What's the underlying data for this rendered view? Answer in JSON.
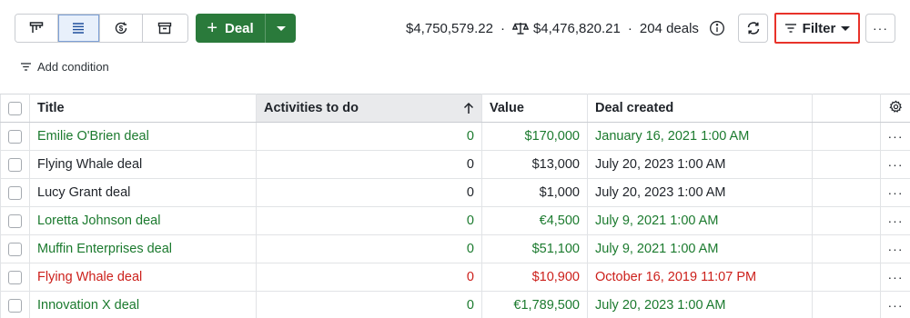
{
  "toolbar": {
    "views": [
      {
        "name": "pipeline-view",
        "icon": "kanban-icon",
        "active": false
      },
      {
        "name": "list-view",
        "icon": "list-icon",
        "active": true
      },
      {
        "name": "forecast-view",
        "icon": "dollar-cycle-icon",
        "active": false
      },
      {
        "name": "archive-view",
        "icon": "archive-icon",
        "active": false
      }
    ],
    "deal_label": "Deal",
    "summary": {
      "total": "$4,750,579.22",
      "weighted": "$4,476,820.21",
      "count": "204 deals"
    },
    "filter_label": "Filter",
    "add_condition_label": "Add condition"
  },
  "table": {
    "columns": [
      "Title",
      "Activities to do",
      "Value",
      "Deal created"
    ],
    "rows": [
      {
        "title": "Emilie O'Brien deal",
        "activities": "0",
        "value": "$170,000",
        "created": "January 16, 2021 1:00 AM",
        "status": "green"
      },
      {
        "title": "Flying Whale deal",
        "activities": "0",
        "value": "$13,000",
        "created": "July 20, 2023 1:00 AM",
        "status": "black"
      },
      {
        "title": "Lucy Grant deal",
        "activities": "0",
        "value": "$1,000",
        "created": "July 20, 2023 1:00 AM",
        "status": "black"
      },
      {
        "title": "Loretta Johnson deal",
        "activities": "0",
        "value": "€4,500",
        "created": "July 9, 2021 1:00 AM",
        "status": "green"
      },
      {
        "title": "Muffin Enterprises deal",
        "activities": "0",
        "value": "$51,100",
        "created": "July 9, 2021 1:00 AM",
        "status": "green"
      },
      {
        "title": "Flying Whale deal",
        "activities": "0",
        "value": "$10,900",
        "created": "October 16, 2019 11:07 PM",
        "status": "red"
      },
      {
        "title": "Innovation X deal",
        "activities": "0",
        "value": "€1,789,500",
        "created": "July 20, 2023 1:00 AM",
        "status": "green"
      }
    ]
  },
  "colors": {
    "deal_button": "#2a7a3b",
    "status_green": "#1b7a2e",
    "status_red": "#cc1f1a",
    "filter_highlight": "#e8322a"
  }
}
